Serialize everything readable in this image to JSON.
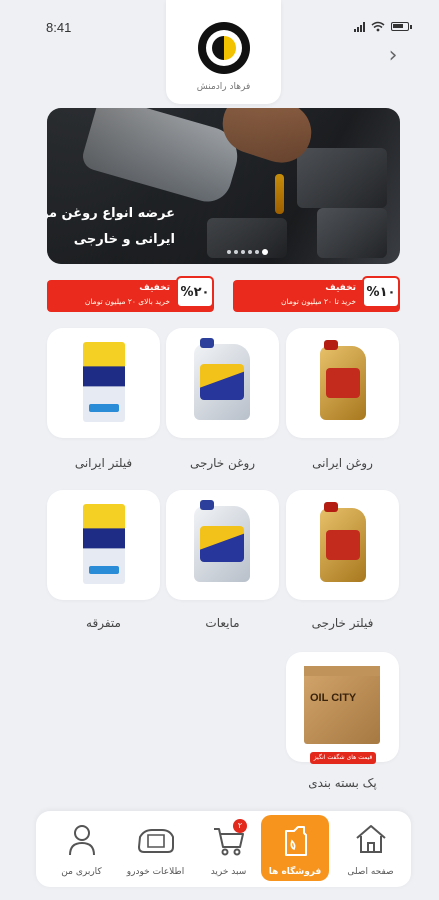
{
  "status_bar": {
    "time": "8:41"
  },
  "header": {
    "owner_name": "فرهاد رادمنش",
    "back_glyph": "›"
  },
  "banner": {
    "line1": "عرضه انواع روغن موتور",
    "line2": "ایرانی و خارجی",
    "slide_count": 6,
    "active_slide": 6
  },
  "discounts": [
    {
      "percent": "%۱۰",
      "title": "تخفیف",
      "desc": "خرید تا ۲۰ میلیون تومان"
    },
    {
      "percent": "%۲۰",
      "title": "تخفیف",
      "desc": "خرید بالای ۲۰ میلیون تومان"
    }
  ],
  "categories": [
    {
      "label": "روغن ایرانی",
      "icon": "gold-oil-jug-icon"
    },
    {
      "label": "روغن خارجی",
      "icon": "blue-oil-jug-icon"
    },
    {
      "label": "فیلتر ایرانی",
      "icon": "filter-box-icon"
    },
    {
      "label": "فیلتر خارجی",
      "icon": "gold-oil-jug-icon"
    },
    {
      "label": "مایعات",
      "icon": "blue-oil-jug-icon"
    },
    {
      "label": "متفرقه",
      "icon": "filter-box-icon"
    },
    {
      "label": "پک بسته بندی",
      "icon": "cardboard-box-icon",
      "box_text": "OIL CITY",
      "badge": "قیمت های شگفت انگیز"
    }
  ],
  "bottom_nav": {
    "items": [
      {
        "label": "صفحه اصلی",
        "icon": "home-icon"
      },
      {
        "label": "فروشگاه ها",
        "icon": "oil-can-icon",
        "active": true
      },
      {
        "label": "سبد خرید",
        "icon": "cart-icon",
        "badge": "۲"
      },
      {
        "label": "اطلاعات خودرو",
        "icon": "car-icon"
      },
      {
        "label": "کاربری من",
        "icon": "user-icon"
      }
    ]
  },
  "colors": {
    "accent_orange": "#f7941d",
    "discount_red": "#ea2a1d",
    "background": "#eef0f4"
  }
}
